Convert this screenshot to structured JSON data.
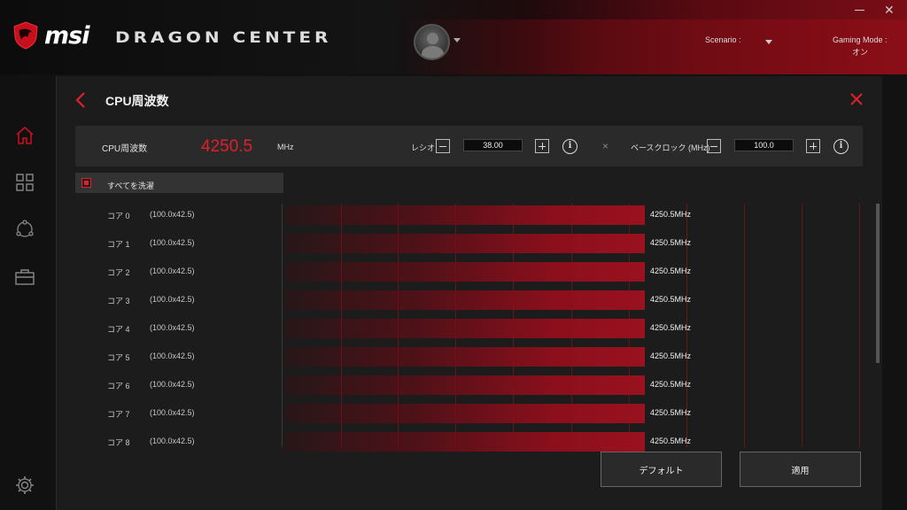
{
  "header": {
    "brand": "msi",
    "app_title": "DRAGON CENTER",
    "scenario_label": "Scenario :",
    "gaming_mode_label": "Gaming Mode :",
    "gaming_mode_value": "オン"
  },
  "sidebar": {
    "items": [
      {
        "icon": "home-icon"
      },
      {
        "icon": "grid-icon"
      },
      {
        "icon": "network-icon"
      },
      {
        "icon": "toolbox-icon"
      },
      {
        "icon": "gear-icon"
      }
    ]
  },
  "panel": {
    "title": "CPU周波数",
    "freq_label": "CPU周波数",
    "freq_value": "4250.5",
    "freq_unit": "MHz",
    "ratio_label": "レシオ",
    "ratio_value": "38.00",
    "bclk_label": "ベースクロック (MHz)",
    "bclk_value": "100.0",
    "times_symbol": "×",
    "info_glyph": "i",
    "select_all_label": "すべてを洗濯"
  },
  "cores": [
    {
      "name": "コア 0",
      "mult": "(100.0x42.5)",
      "value": "4250.5MHz"
    },
    {
      "name": "コア 1",
      "mult": "(100.0x42.5)",
      "value": "4250.5MHz"
    },
    {
      "name": "コア 2",
      "mult": "(100.0x42.5)",
      "value": "4250.5MHz"
    },
    {
      "name": "コア 3",
      "mult": "(100.0x42.5)",
      "value": "4250.5MHz"
    },
    {
      "name": "コア 4",
      "mult": "(100.0x42.5)",
      "value": "4250.5MHz"
    },
    {
      "name": "コア 5",
      "mult": "(100.0x42.5)",
      "value": "4250.5MHz"
    },
    {
      "name": "コア 6",
      "mult": "(100.0x42.5)",
      "value": "4250.5MHz"
    },
    {
      "name": "コア 7",
      "mult": "(100.0x42.5)",
      "value": "4250.5MHz"
    },
    {
      "name": "コア 8",
      "mult": "(100.0x42.5)",
      "value": "4250.5MHz"
    }
  ],
  "buttons": {
    "default_label": "デフォルト",
    "apply_label": "適用"
  },
  "colors": {
    "accent": "#e0202a",
    "bar": "#8c0f1c",
    "panel_bg": "#1c1c1c"
  }
}
